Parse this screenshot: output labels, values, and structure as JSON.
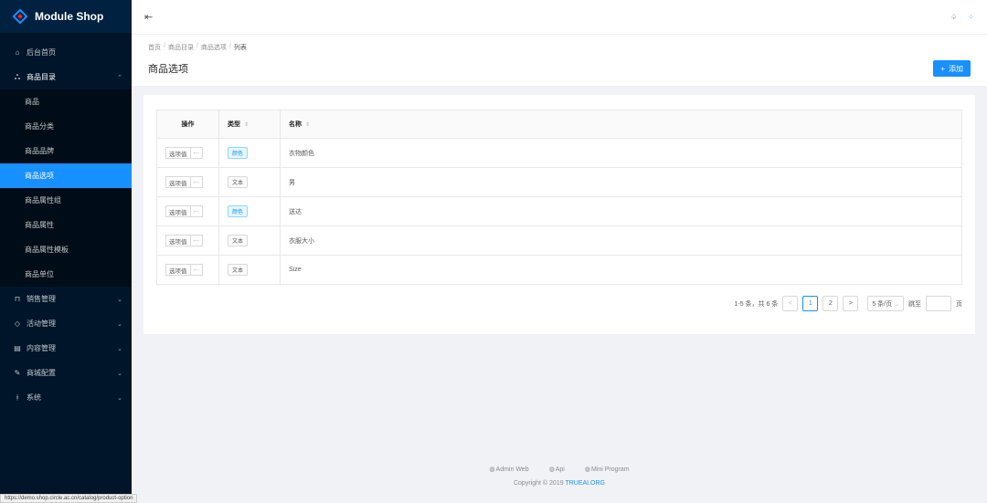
{
  "app": {
    "title": "Module Shop"
  },
  "sidebar": {
    "items": [
      {
        "label": "后台首页",
        "icon": "home-icon"
      },
      {
        "label": "商品目录",
        "icon": "catalog-icon",
        "open": true
      },
      {
        "label": "销售管理",
        "icon": "sales-icon"
      },
      {
        "label": "活动管理",
        "icon": "promotion-icon"
      },
      {
        "label": "内容管理",
        "icon": "content-icon"
      },
      {
        "label": "商城配置",
        "icon": "tool-icon"
      },
      {
        "label": "系统",
        "icon": "system-icon"
      }
    ],
    "catalog_children": [
      "商品",
      "商品分类",
      "商品品牌",
      "商品选项",
      "商品属性组",
      "商品属性",
      "商品属性模板",
      "商品单位"
    ],
    "active_child": "商品选项"
  },
  "breadcrumb": [
    "首页",
    "商品目录",
    "商品选项",
    "列表"
  ],
  "page": {
    "title": "商品选项",
    "add_label": "添加"
  },
  "table": {
    "headers": {
      "op": "操作",
      "type": "类型",
      "name": "名称"
    },
    "row_button": "选项值",
    "more": "···",
    "rows": [
      {
        "type": "颜色",
        "type_style": "blue",
        "name": "衣物颜色"
      },
      {
        "type": "文本",
        "type_style": "default",
        "name": "男"
      },
      {
        "type": "颜色",
        "type_style": "blue",
        "name": "送达"
      },
      {
        "type": "文本",
        "type_style": "default",
        "name": "衣服大小"
      },
      {
        "type": "文本",
        "type_style": "default",
        "name": "Size"
      }
    ]
  },
  "pagination": {
    "total_text": "1-5 条，共 6 条",
    "prev": "<",
    "pages": [
      "1",
      "2"
    ],
    "current": "1",
    "next": ">",
    "page_size": "5 条/页",
    "jump_label": "跳至",
    "page_suffix": "页"
  },
  "footer": {
    "links": [
      "Admin Web",
      "Api",
      "Mini Program"
    ],
    "copyright_prefix": "Copyright",
    "copyright_year": "2019",
    "org": "TRUEAI.ORG"
  },
  "status_url": "https://demo.shop.circle.ac.cn/catalog/product-option",
  "colors": {
    "sidebar": "#001529",
    "accent": "#1890ff"
  }
}
